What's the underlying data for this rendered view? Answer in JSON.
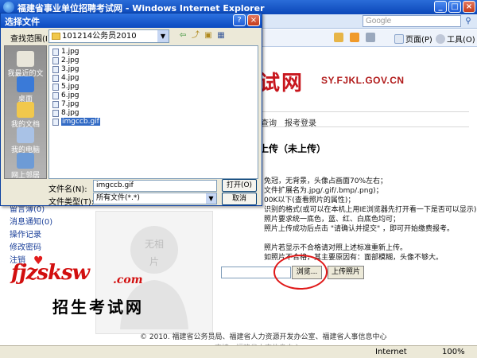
{
  "browser": {
    "title": "福建省事业单位招聘考试网 - Windows Internet Explorer",
    "search_placeholder": "Google",
    "toolbar": {
      "page_label": "页面(P)",
      "tools_label": "工具(O)"
    },
    "status": {
      "zone": "Internet",
      "zoom": "100%"
    }
  },
  "site": {
    "brand_text": "试网",
    "url": "SY.FJKL.GOV.CN",
    "nav": [
      "查询",
      "报考登录"
    ],
    "upload_heading": "上传（未上传）",
    "instructions": [
      "免冠，无背景，头像占画面70%左右；",
      "文件扩展名为.jpg/.gif/.bmp/.png)；",
      "00K以下(查看照片的属性)；",
      "识别的格式(或可以在本机上用IE浏览器先打开看一下是否可以显示)；",
      "照片要求统一底色，蓝、红、白底色均可；",
      "照片上传成功后点击 \"请确认并提交\" ，即可开始缴费报考。",
      "",
      "照片若显示不合格请对照上述标准重新上传。",
      "如照片不合格，其主要原因有：面部模糊，头像不够大。"
    ],
    "photo_placeholder": "无相片",
    "left_menu": [
      {
        "label": "留言簿",
        "count": "(0)"
      },
      {
        "label": "消息通知",
        "count": "(0)"
      },
      {
        "label": "操作记录",
        "count": ""
      },
      {
        "label": "修改密码",
        "count": ""
      },
      {
        "label": "注销",
        "count": ""
      }
    ],
    "browse_label": "浏览...",
    "upload_label": "上传照片",
    "footer": "© 2010. 福建省公务员局、福建省人力资源开发办公室、福建省人事信息中心",
    "footer2": "支持：福建省人事信息中心"
  },
  "watermark": {
    "latin": "fjzsksw",
    "dotcom": ".com",
    "cn": "招生考试网"
  },
  "dialog": {
    "title": "选择文件",
    "help": "?",
    "close": "×",
    "lookin_label": "查找范围(I):",
    "lookin_value": "101214公务员2010",
    "places": [
      "我最近的文档",
      "桌面",
      "我的文档",
      "我的电脑",
      "网上邻居"
    ],
    "files": [
      "1.jpg",
      "2.jpg",
      "3.jpg",
      "4.jpg",
      "5.jpg",
      "6.jpg",
      "7.jpg",
      "8.jpg",
      "imgccb.gif"
    ],
    "selected_file": "imgccb.gif",
    "filename_label": "文件名(N):",
    "filename_value": "imgccb.gif",
    "filetype_label": "文件类型(T):",
    "filetype_value": "所有文件(*.*)",
    "open_label": "打开(O)",
    "cancel_label": "取消"
  },
  "colors": {
    "title_blue": "#0b47b8",
    "brand_red": "#c8161d",
    "highlight_red": "#e01818",
    "selection_blue": "#316ac5"
  }
}
